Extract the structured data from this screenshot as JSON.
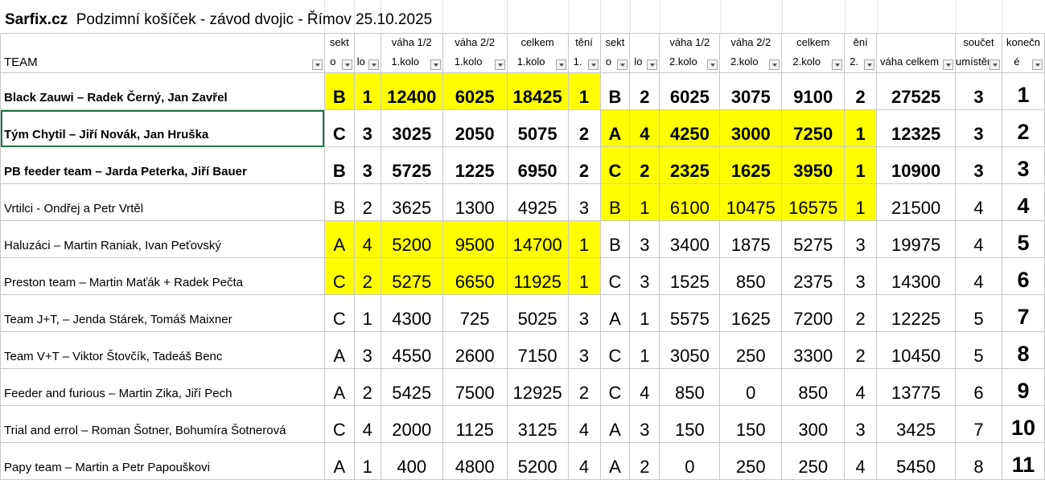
{
  "title": {
    "site": "Sarfix.cz",
    "event": "Podzimní košíček - závod dvojic - Římov 25.10.2025"
  },
  "headers": [
    {
      "top": "",
      "bottom": "TEAM"
    },
    {
      "top": "sekt",
      "bottom": "o"
    },
    {
      "top": "",
      "bottom": "lo"
    },
    {
      "top": "váha 1/2",
      "bottom": "1.kolo"
    },
    {
      "top": "váha 2/2",
      "bottom": "1.kolo"
    },
    {
      "top": "celkem",
      "bottom": "1.kolo"
    },
    {
      "top": "tění",
      "bottom": "1."
    },
    {
      "top": "sekt",
      "bottom": "o"
    },
    {
      "top": "",
      "bottom": "lo"
    },
    {
      "top": "váha 1/2",
      "bottom": "2.kolo"
    },
    {
      "top": "váha 2/2",
      "bottom": "2.kolo"
    },
    {
      "top": "celkem",
      "bottom": "2.kolo"
    },
    {
      "top": "ění",
      "bottom": "2."
    },
    {
      "top": "",
      "bottom": "váha celkem"
    },
    {
      "top": "součet",
      "bottom": "umístění"
    },
    {
      "top": "konečn",
      "bottom": "é"
    }
  ],
  "rows": [
    {
      "team": "Black Zauwi – Radek Černý, Jan Zavřel",
      "r1_sector": "B",
      "r1_place": "1",
      "r1_w1": "12400",
      "r1_w2": "6025",
      "r1_total": "18425",
      "r1_rank": "1",
      "r2_sector": "B",
      "r2_place": "2",
      "r2_w1": "6025",
      "r2_w2": "3075",
      "r2_total": "9100",
      "r2_rank": "2",
      "total_weight": "27525",
      "sum_places": "3",
      "final": "1"
    },
    {
      "team": "Tým Chytil – Jiří Novák, Jan Hruška",
      "r1_sector": "C",
      "r1_place": "3",
      "r1_w1": "3025",
      "r1_w2": "2050",
      "r1_total": "5075",
      "r1_rank": "2",
      "r2_sector": "A",
      "r2_place": "4",
      "r2_w1": "4250",
      "r2_w2": "3000",
      "r2_total": "7250",
      "r2_rank": "1",
      "total_weight": "12325",
      "sum_places": "3",
      "final": "2"
    },
    {
      "team": "PB feeder team – Jarda Peterka, Jiří Bauer",
      "r1_sector": "B",
      "r1_place": "3",
      "r1_w1": "5725",
      "r1_w2": "1225",
      "r1_total": "6950",
      "r1_rank": "2",
      "r2_sector": "C",
      "r2_place": "2",
      "r2_w1": "2325",
      "r2_w2": "1625",
      "r2_total": "3950",
      "r2_rank": "1",
      "total_weight": "10900",
      "sum_places": "3",
      "final": "3"
    },
    {
      "team": "Vrtilci - Ondřej a Petr Vrtěl",
      "r1_sector": "B",
      "r1_place": "2",
      "r1_w1": "3625",
      "r1_w2": "1300",
      "r1_total": "4925",
      "r1_rank": "3",
      "r2_sector": "B",
      "r2_place": "1",
      "r2_w1": "6100",
      "r2_w2": "10475",
      "r2_total": "16575",
      "r2_rank": "1",
      "total_weight": "21500",
      "sum_places": "4",
      "final": "4"
    },
    {
      "team": "Haluzáci – Martin Raniak, Ivan Peťovský",
      "r1_sector": "A",
      "r1_place": "4",
      "r1_w1": "5200",
      "r1_w2": "9500",
      "r1_total": "14700",
      "r1_rank": "1",
      "r2_sector": "B",
      "r2_place": "3",
      "r2_w1": "3400",
      "r2_w2": "1875",
      "r2_total": "5275",
      "r2_rank": "3",
      "total_weight": "19975",
      "sum_places": "4",
      "final": "5"
    },
    {
      "team": "Preston  team – Martin Maťák + Radek Pečta",
      "r1_sector": "C",
      "r1_place": "2",
      "r1_w1": "5275",
      "r1_w2": "6650",
      "r1_total": "11925",
      "r1_rank": "1",
      "r2_sector": "C",
      "r2_place": "3",
      "r2_w1": "1525",
      "r2_w2": "850",
      "r2_total": "2375",
      "r2_rank": "3",
      "total_weight": "14300",
      "sum_places": "4",
      "final": "6"
    },
    {
      "team": "Team J+T, – Jenda Stárek, Tomáš Maixner",
      "r1_sector": "C",
      "r1_place": "1",
      "r1_w1": "4300",
      "r1_w2": "725",
      "r1_total": "5025",
      "r1_rank": "3",
      "r2_sector": "A",
      "r2_place": "1",
      "r2_w1": "5575",
      "r2_w2": "1625",
      "r2_total": "7200",
      "r2_rank": "2",
      "total_weight": "12225",
      "sum_places": "5",
      "final": "7"
    },
    {
      "team": "Team V+T  – Viktor Štovčík, Tadeáš Benc",
      "r1_sector": "A",
      "r1_place": "3",
      "r1_w1": "4550",
      "r1_w2": "2600",
      "r1_total": "7150",
      "r1_rank": "3",
      "r2_sector": "C",
      "r2_place": "1",
      "r2_w1": "3050",
      "r2_w2": "250",
      "r2_total": "3300",
      "r2_rank": "2",
      "total_weight": "10450",
      "sum_places": "5",
      "final": "8"
    },
    {
      "team": "Feeder and furious – Martin Zika, Jiří Pech",
      "r1_sector": "A",
      "r1_place": "2",
      "r1_w1": "5425",
      "r1_w2": "7500",
      "r1_total": "12925",
      "r1_rank": "2",
      "r2_sector": "C",
      "r2_place": "4",
      "r2_w1": "850",
      "r2_w2": "0",
      "r2_total": "850",
      "r2_rank": "4",
      "total_weight": "13775",
      "sum_places": "6",
      "final": "9"
    },
    {
      "team": "Trial and errol – Roman Šotner, Bohumíra Šotnerová",
      "r1_sector": "C",
      "r1_place": "4",
      "r1_w1": "2000",
      "r1_w2": "1125",
      "r1_total": "3125",
      "r1_rank": "4",
      "r2_sector": "A",
      "r2_place": "3",
      "r2_w1": "150",
      "r2_w2": "150",
      "r2_total": "300",
      "r2_rank": "3",
      "total_weight": "3425",
      "sum_places": "7",
      "final": "10"
    },
    {
      "team": "Papy team –  Martin a Petr Papouškovi",
      "r1_sector": "A",
      "r1_place": "1",
      "r1_w1": "400",
      "r1_w2": "4800",
      "r1_total": "5200",
      "r1_rank": "4",
      "r2_sector": "A",
      "r2_place": "2",
      "r2_w1": "0",
      "r2_w2": "250",
      "r2_total": "250",
      "r2_rank": "4",
      "total_weight": "5450",
      "sum_places": "8",
      "final": "11"
    }
  ],
  "colors": {
    "highlight": "#ffff00",
    "selection": "#217346",
    "gridline": "#c8c8c8"
  }
}
